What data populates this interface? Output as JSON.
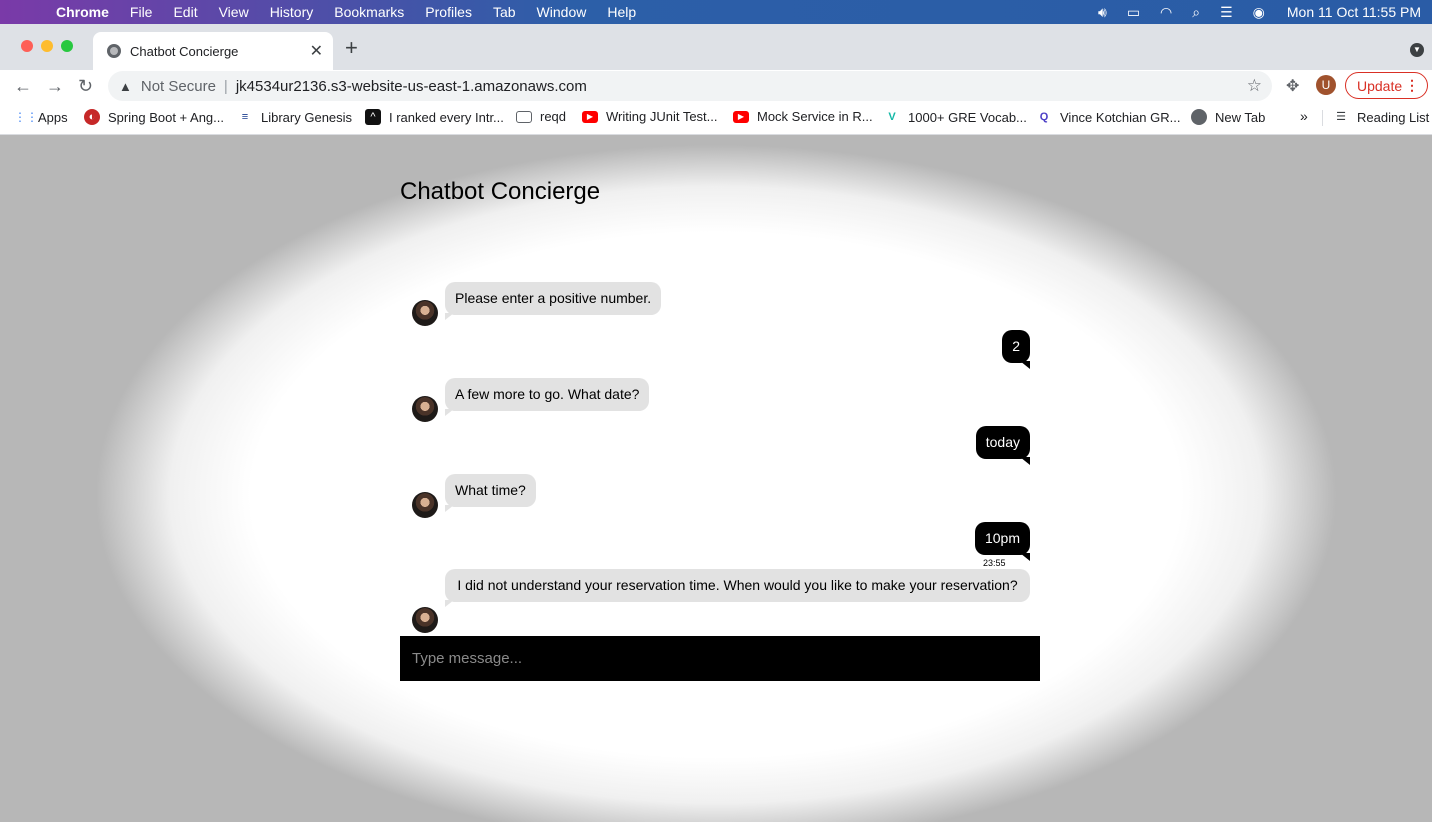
{
  "menubar": {
    "app": "Chrome",
    "items": [
      "File",
      "Edit",
      "View",
      "History",
      "Bookmarks",
      "Profiles",
      "Tab",
      "Window",
      "Help"
    ],
    "clock": "Mon 11 Oct  11:55 PM"
  },
  "tab": {
    "title": "Chatbot Concierge",
    "close": "✕"
  },
  "toolbar": {
    "security_label": "Not Secure",
    "url": "jk4534ur2136.s3-website-us-east-1.amazonaws.com",
    "profile_initial": "U",
    "update_label": "Update"
  },
  "bookmarks": [
    {
      "label": "Apps"
    },
    {
      "label": "Spring Boot + Ang..."
    },
    {
      "label": "Library Genesis"
    },
    {
      "label": "I ranked every Intr..."
    },
    {
      "label": "reqd"
    },
    {
      "label": "Writing JUnit Test..."
    },
    {
      "label": "Mock Service in R..."
    },
    {
      "label": "1000+ GRE Vocab..."
    },
    {
      "label": "Vince Kotchian GR..."
    },
    {
      "label": "New Tab"
    }
  ],
  "reading_list": "Reading List",
  "page": {
    "title": "Chatbot Concierge",
    "messages": [
      {
        "from": "bot",
        "text": "Please enter a positive number."
      },
      {
        "from": "user",
        "text": "2"
      },
      {
        "from": "bot",
        "text": "A few more to go. What date?"
      },
      {
        "from": "user",
        "text": "today"
      },
      {
        "from": "bot",
        "text": "What time?"
      },
      {
        "from": "user",
        "text": "10pm",
        "time": "23:55"
      },
      {
        "from": "bot",
        "text": "I did not understand your reservation time. When would you like to make your reservation?"
      }
    ],
    "input_placeholder": "Type message..."
  }
}
